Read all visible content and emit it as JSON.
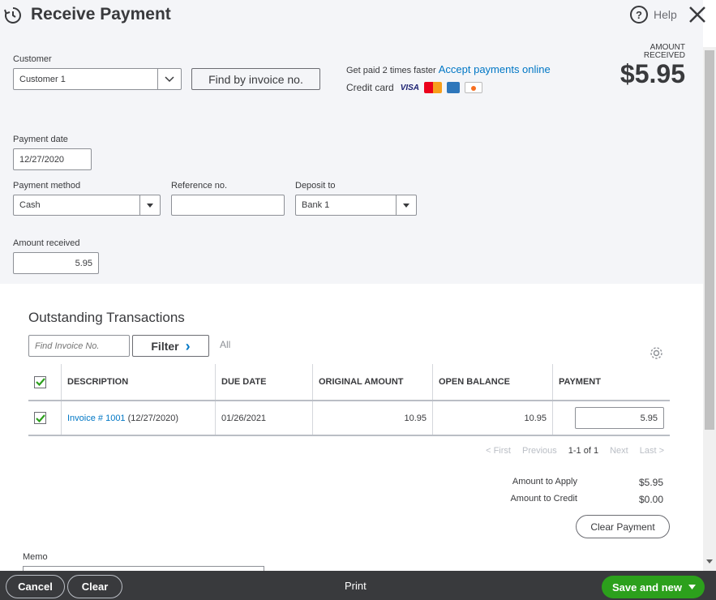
{
  "header": {
    "title": "Receive Payment",
    "help_label": "Help",
    "help_glyph": "?"
  },
  "customer": {
    "label": "Customer",
    "value": "Customer 1",
    "find_button": "Find by invoice no."
  },
  "promo": {
    "text": "Get paid 2 times faster",
    "link": "Accept payments online",
    "credit_label": "Credit card",
    "cards": [
      "visa-icon",
      "mastercard-icon",
      "amex-icon",
      "discover-icon"
    ]
  },
  "amount_summary": {
    "label_line1": "AMOUNT",
    "label_line2": "RECEIVED",
    "value": "$5.95"
  },
  "form": {
    "payment_date_label": "Payment date",
    "payment_date": "12/27/2020",
    "payment_method_label": "Payment method",
    "payment_method": "Cash",
    "reference_label": "Reference no.",
    "reference_value": "",
    "deposit_label": "Deposit to",
    "deposit_value": "Bank 1",
    "amount_received_label": "Amount received",
    "amount_received": "5.95"
  },
  "outstanding": {
    "title": "Outstanding Transactions",
    "find_placeholder": "Find Invoice No.",
    "filter_label": "Filter",
    "filter_chevron": "›",
    "all_label": "All",
    "columns": {
      "description": "DESCRIPTION",
      "due_date": "DUE DATE",
      "original_amount": "ORIGINAL AMOUNT",
      "open_balance": "OPEN BALANCE",
      "payment": "PAYMENT"
    },
    "rows": [
      {
        "checked": true,
        "invoice_link": "Invoice # 1001",
        "invoice_date": " (12/27/2020)",
        "due_date": "01/26/2021",
        "original_amount": "10.95",
        "open_balance": "10.95",
        "payment": "5.95"
      }
    ],
    "pager": {
      "first": "< First",
      "previous": "Previous",
      "range": "1-1 of 1",
      "next": "Next",
      "last": "Last >"
    }
  },
  "summary": {
    "apply_label": "Amount to Apply",
    "apply_value": "$5.95",
    "credit_label": "Amount to Credit",
    "credit_value": "$0.00",
    "clear_payment": "Clear Payment"
  },
  "memo": {
    "label": "Memo"
  },
  "footer": {
    "cancel": "Cancel",
    "clear": "Clear",
    "print": "Print",
    "save_new": "Save and new"
  },
  "colors": {
    "accent": "#0077c5",
    "save_green": "#2ca01c",
    "footer_bg": "#393a3d",
    "check_green": "#2ca01c"
  }
}
